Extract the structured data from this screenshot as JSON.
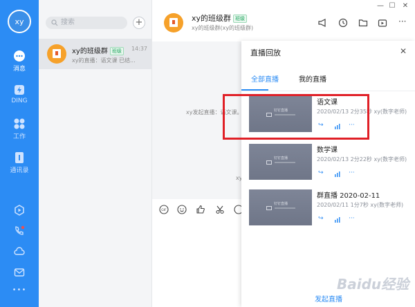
{
  "user": {
    "avatar_text": "xy"
  },
  "rail": {
    "items": [
      {
        "label": "消息",
        "icon": "chat-bubble-icon"
      },
      {
        "label": "DING",
        "icon": "ding-icon"
      },
      {
        "label": "工作",
        "icon": "apps-grid-icon"
      },
      {
        "label": "通讯录",
        "icon": "contacts-icon"
      }
    ],
    "bottom_icons": [
      "hexagon-icon",
      "phone-icon",
      "cloud-icon",
      "mail-icon",
      "more-icon"
    ],
    "more": "•••"
  },
  "list": {
    "search_placeholder": "搜索",
    "add_label": "+",
    "chats": [
      {
        "name": "xy的班级群",
        "tag": "班级",
        "time": "14:37",
        "preview": "xy的直播：语文课 已结..."
      }
    ]
  },
  "header": {
    "title": "xy的班级群",
    "tag": "班级",
    "subtitle": "xy的班级群(xy的班级群)",
    "window_controls": [
      "?",
      "—",
      "☐",
      "✕"
    ]
  },
  "messages": {
    "system_1": "xy发起直播：语文课。",
    "system_2": "xy"
  },
  "panel": {
    "title": "直播回放",
    "close": "✕",
    "tabs": [
      {
        "label": "全部直播",
        "active": true
      },
      {
        "label": "我的直播",
        "active": false
      }
    ],
    "thumb_label": "钉钉直播",
    "recordings": [
      {
        "title": "语文课",
        "meta": "2020/02/13 2分35秒 xy(数字老师)"
      },
      {
        "title": "数学课",
        "meta": "2020/02/13 2分22秒 xy(数字老师)"
      },
      {
        "title": "群直播 2020-02-11",
        "meta": "2020/02/11 1分7秒 xy(数字老师)"
      }
    ],
    "actions": [
      "↪",
      "📊",
      "···"
    ],
    "start_live": "发起直播"
  },
  "watermark": "Baidu经验",
  "colors": {
    "accent": "#2c8cf4",
    "highlight": "#e01f26"
  }
}
